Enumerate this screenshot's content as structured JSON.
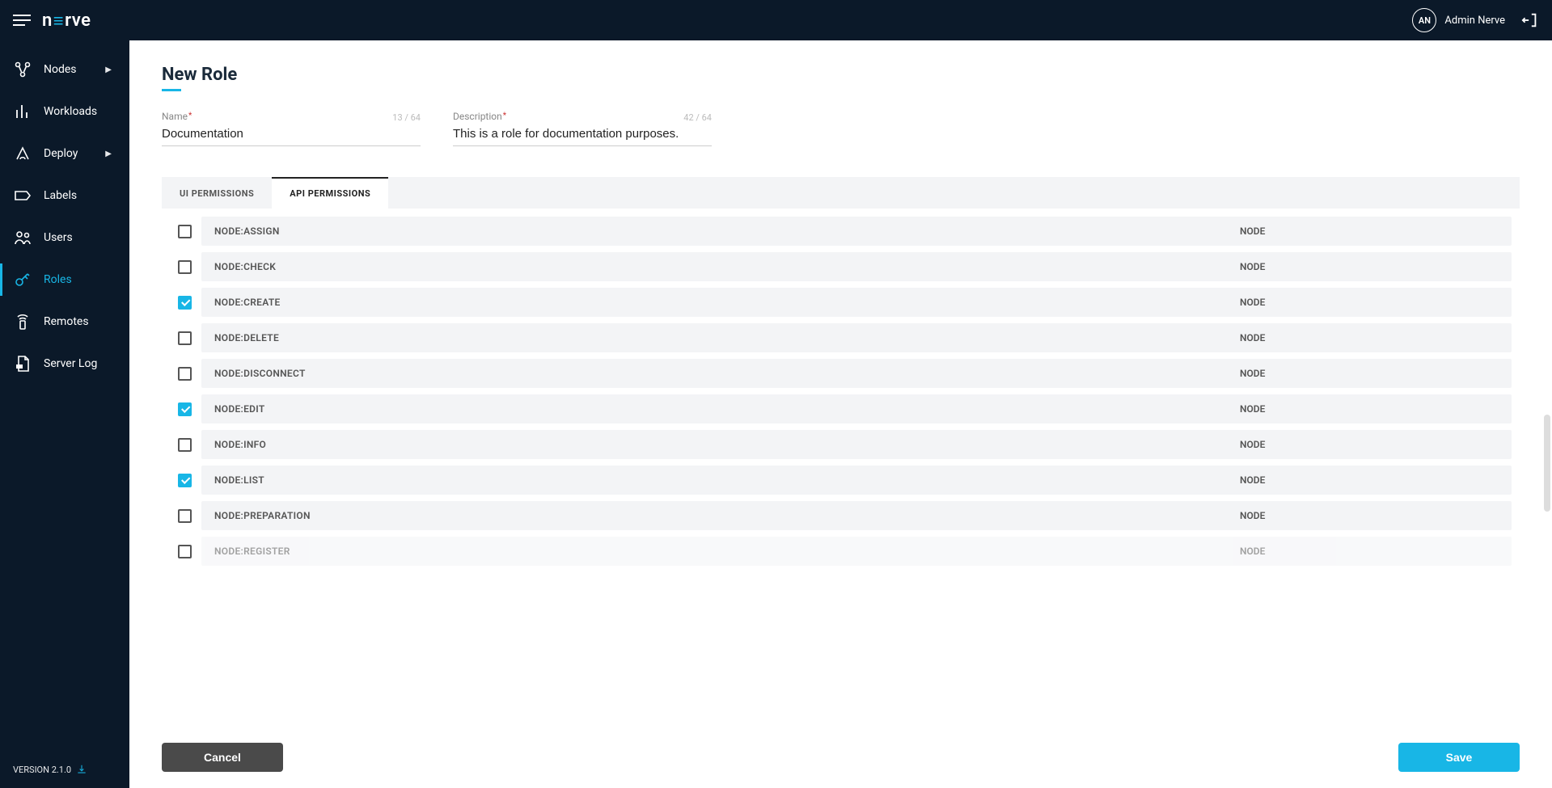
{
  "header": {
    "avatar_initials": "AN",
    "username": "Admin Nerve",
    "logo_text_left": "n",
    "logo_text_right": "rve"
  },
  "sidebar": {
    "items": [
      {
        "label": "Nodes",
        "has_submenu": true
      },
      {
        "label": "Workloads",
        "has_submenu": false
      },
      {
        "label": "Deploy",
        "has_submenu": true
      },
      {
        "label": "Labels",
        "has_submenu": false
      },
      {
        "label": "Users",
        "has_submenu": false
      },
      {
        "label": "Roles",
        "has_submenu": false
      },
      {
        "label": "Remotes",
        "has_submenu": false
      },
      {
        "label": "Server Log",
        "has_submenu": false
      }
    ],
    "active_index": 5,
    "version": "VERSION 2.1.0"
  },
  "page": {
    "title": "New Role",
    "name_label": "Name",
    "name_value": "Documentation",
    "name_counter": "13 / 64",
    "desc_label": "Description",
    "desc_value": "This is a role for documentation purposes.",
    "desc_counter": "42 / 64"
  },
  "tabs": [
    {
      "label": "UI PERMISSIONS"
    },
    {
      "label": "API PERMISSIONS"
    }
  ],
  "active_tab": 1,
  "permissions": [
    {
      "name": "NODE:ASSIGN",
      "category": "NODE",
      "checked": false
    },
    {
      "name": "NODE:CHECK",
      "category": "NODE",
      "checked": false
    },
    {
      "name": "NODE:CREATE",
      "category": "NODE",
      "checked": true
    },
    {
      "name": "NODE:DELETE",
      "category": "NODE",
      "checked": false
    },
    {
      "name": "NODE:DISCONNECT",
      "category": "NODE",
      "checked": false
    },
    {
      "name": "NODE:EDIT",
      "category": "NODE",
      "checked": true
    },
    {
      "name": "NODE:INFO",
      "category": "NODE",
      "checked": false
    },
    {
      "name": "NODE:LIST",
      "category": "NODE",
      "checked": true
    },
    {
      "name": "NODE:PREPARATION",
      "category": "NODE",
      "checked": false
    },
    {
      "name": "NODE:REGISTER",
      "category": "NODE",
      "checked": false
    }
  ],
  "footer": {
    "cancel": "Cancel",
    "save": "Save"
  }
}
